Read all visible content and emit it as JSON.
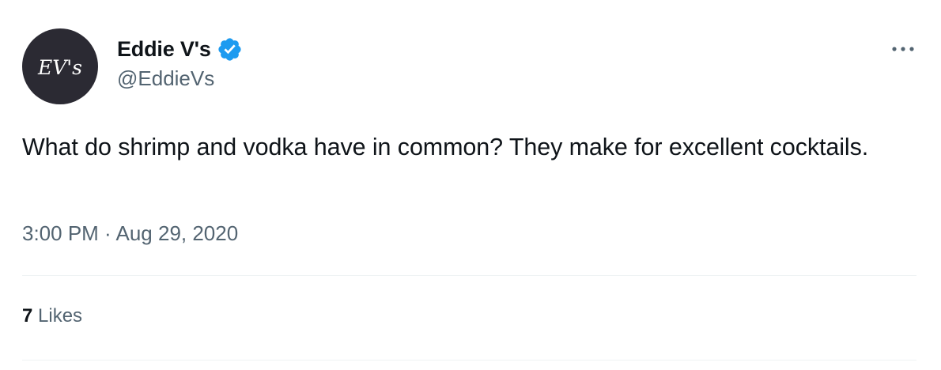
{
  "author": {
    "display_name": "Eddie V's",
    "handle": "@EddieVs",
    "verified": true,
    "avatar_text": "EV's",
    "avatar_bg_color": "#2b2a33",
    "verified_color": "#1d9bf0"
  },
  "tweet": {
    "text": "What do shrimp and vodka have in common? They make for excellent cocktails.",
    "timestamp": "3:00 PM · Aug 29, 2020"
  },
  "stats": {
    "likes_count": "7",
    "likes_label": "Likes"
  },
  "icons": {
    "more": "more-horizontal-icon",
    "verified": "verified-badge-icon"
  },
  "colors": {
    "text_primary": "#0f1419",
    "text_secondary": "#536471",
    "divider": "#eff3f4"
  }
}
